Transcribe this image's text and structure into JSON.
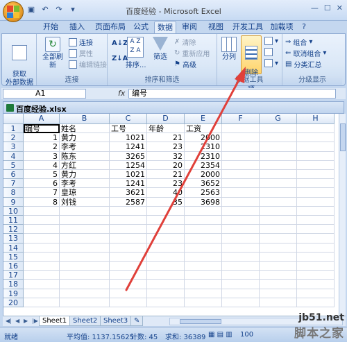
{
  "window": {
    "title": "百度经验 - Microsoft Excel",
    "controls": [
      "—",
      "☐",
      "✕"
    ]
  },
  "qat": {
    "icons": [
      "save-icon",
      "undo-icon",
      "redo-icon",
      "customize-icon"
    ]
  },
  "ribbon": {
    "tabs": [
      "开始",
      "插入",
      "页面布局",
      "公式",
      "数据",
      "审阅",
      "视图",
      "开发工具",
      "加载项"
    ],
    "active_tab": "数据",
    "groups": {
      "get_external": {
        "label": "",
        "button": "获取\n外部数据"
      },
      "connections": {
        "label": "连接",
        "refresh_all": "全部刷新",
        "items": [
          "连接",
          "属性",
          "编辑链接"
        ]
      },
      "sort_filter": {
        "label": "排序和筛选",
        "sort": "排序...",
        "filter": "筛选",
        "items": [
          "清除",
          "重新应用",
          "高级"
        ]
      },
      "data_tools": {
        "label": "数据工具",
        "split": "分列",
        "remove_dup": "删除\n重复项"
      },
      "outline": {
        "label": "分级显示",
        "items": [
          "组合",
          "取消组合",
          "分类汇总"
        ]
      }
    }
  },
  "formula_bar": {
    "name_box": "A1",
    "fx": "fx",
    "value": "编号"
  },
  "workbook": {
    "file_name": "百度经验.xlsx"
  },
  "sheet": {
    "columns": [
      "A",
      "B",
      "C",
      "D",
      "E",
      "F",
      "G",
      "H"
    ],
    "rows": [
      "1",
      "2",
      "3",
      "4",
      "5",
      "6",
      "7",
      "8",
      "9",
      "10",
      "11",
      "12",
      "13",
      "14",
      "15",
      "16",
      "17",
      "18",
      "19",
      "20"
    ],
    "data": [
      [
        "编号",
        "姓名",
        "工号",
        "年龄",
        "工资"
      ],
      [
        "1",
        "黄力",
        "1021",
        "21",
        "2000"
      ],
      [
        "2",
        "李考",
        "1241",
        "23",
        "2310"
      ],
      [
        "3",
        "陈东",
        "3265",
        "32",
        "2310"
      ],
      [
        "4",
        "方红",
        "1254",
        "20",
        "2354"
      ],
      [
        "5",
        "黄力",
        "1021",
        "21",
        "2000"
      ],
      [
        "6",
        "李考",
        "1241",
        "23",
        "3652"
      ],
      [
        "7",
        "皇琼",
        "3621",
        "40",
        "2563"
      ],
      [
        "8",
        "刘钱",
        "2587",
        "35",
        "3698"
      ]
    ]
  },
  "sheet_tabs": [
    "Sheet1",
    "Sheet2",
    "Sheet3"
  ],
  "status": {
    "average": "平均值: 1137.15625",
    "count": "计数: 45",
    "sum": "求和: 36389",
    "zoom": "100"
  },
  "watermark": {
    "site": "jb51.net",
    "brand": "脚本之家"
  }
}
